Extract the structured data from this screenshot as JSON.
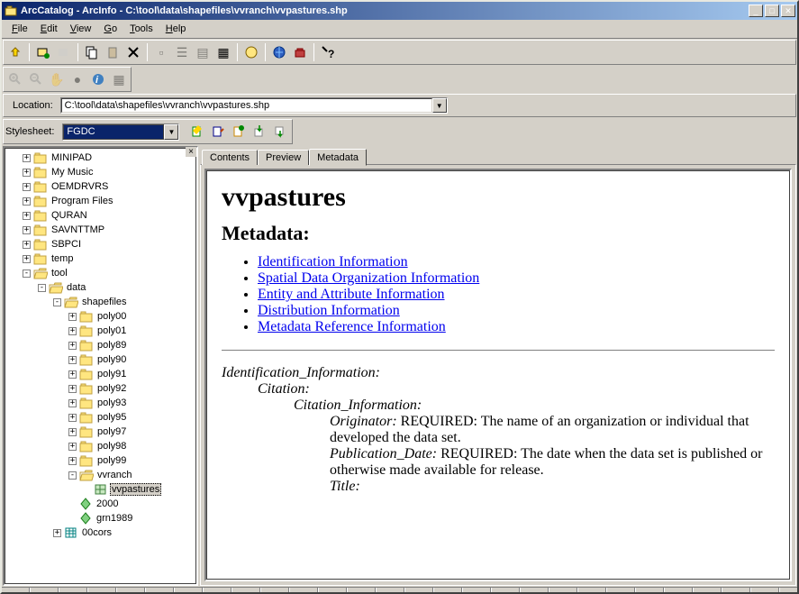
{
  "window": {
    "title": "ArcCatalog - ArcInfo - C:\\tool\\data\\shapefiles\\vvranch\\vvpastures.shp"
  },
  "menu": {
    "file": "File",
    "edit": "Edit",
    "view": "View",
    "go": "Go",
    "tools": "Tools",
    "help": "Help"
  },
  "location": {
    "label": "Location:",
    "value": "C:\\tool\\data\\shapefiles\\vvranch\\vvpastures.shp"
  },
  "stylesheet": {
    "label": "Stylesheet:",
    "value": "FGDC"
  },
  "tree": [
    {
      "level": 1,
      "toggle": "+",
      "icon": "folder",
      "label": "MINIPAD"
    },
    {
      "level": 1,
      "toggle": "+",
      "icon": "folder",
      "label": "My Music"
    },
    {
      "level": 1,
      "toggle": "+",
      "icon": "folder",
      "label": "OEMDRVRS"
    },
    {
      "level": 1,
      "toggle": "+",
      "icon": "folder",
      "label": "Program Files"
    },
    {
      "level": 1,
      "toggle": "+",
      "icon": "folder",
      "label": "QURAN"
    },
    {
      "level": 1,
      "toggle": "+",
      "icon": "folder",
      "label": "SAVNTTMP"
    },
    {
      "level": 1,
      "toggle": "+",
      "icon": "folder",
      "label": "SBPCI"
    },
    {
      "level": 1,
      "toggle": "+",
      "icon": "folder",
      "label": "temp"
    },
    {
      "level": 1,
      "toggle": "-",
      "icon": "folder-open",
      "label": "tool"
    },
    {
      "level": 2,
      "toggle": "-",
      "icon": "folder-open",
      "label": "data"
    },
    {
      "level": 3,
      "toggle": "-",
      "icon": "folder-open",
      "label": "shapefiles"
    },
    {
      "level": 4,
      "toggle": "+",
      "icon": "folder",
      "label": "poly00"
    },
    {
      "level": 4,
      "toggle": "+",
      "icon": "folder",
      "label": "poly01"
    },
    {
      "level": 4,
      "toggle": "+",
      "icon": "folder",
      "label": "poly89"
    },
    {
      "level": 4,
      "toggle": "+",
      "icon": "folder",
      "label": "poly90"
    },
    {
      "level": 4,
      "toggle": "+",
      "icon": "folder",
      "label": "poly91"
    },
    {
      "level": 4,
      "toggle": "+",
      "icon": "folder",
      "label": "poly92"
    },
    {
      "level": 4,
      "toggle": "+",
      "icon": "folder",
      "label": "poly93"
    },
    {
      "level": 4,
      "toggle": "+",
      "icon": "folder",
      "label": "poly95"
    },
    {
      "level": 4,
      "toggle": "+",
      "icon": "folder",
      "label": "poly97"
    },
    {
      "level": 4,
      "toggle": "+",
      "icon": "folder",
      "label": "poly98"
    },
    {
      "level": 4,
      "toggle": "+",
      "icon": "folder",
      "label": "poly99"
    },
    {
      "level": 4,
      "toggle": "-",
      "icon": "folder-open",
      "label": "vvranch"
    },
    {
      "level": 5,
      "toggle": "",
      "icon": "poly",
      "label": "vvpastures",
      "selected": true
    },
    {
      "level": 4,
      "toggle": "",
      "icon": "point",
      "label": "2000"
    },
    {
      "level": 4,
      "toggle": "",
      "icon": "point",
      "label": "grn1989"
    },
    {
      "level": 3,
      "toggle": "+",
      "icon": "table",
      "label": "00cors"
    }
  ],
  "tabs": {
    "contents": "Contents",
    "preview": "Preview",
    "metadata": "Metadata"
  },
  "meta": {
    "title": "vvpastures",
    "heading": "Metadata:",
    "links": [
      "Identification Information",
      "Spatial Data Organization Information",
      "Entity and Attribute Information",
      "Distribution Information",
      "Metadata Reference Information"
    ],
    "id_info": "Identification_Information:",
    "citation": "Citation:",
    "cit_info": "Citation_Information:",
    "originator_label": "Originator:",
    "originator_text": " REQUIRED: The name of an organization or individual that developed the data set.",
    "pubdate_label": "Publication_Date:",
    "pubdate_text": " REQUIRED: The date when the data set is published or otherwise made available for release.",
    "title_label": "Title:"
  }
}
